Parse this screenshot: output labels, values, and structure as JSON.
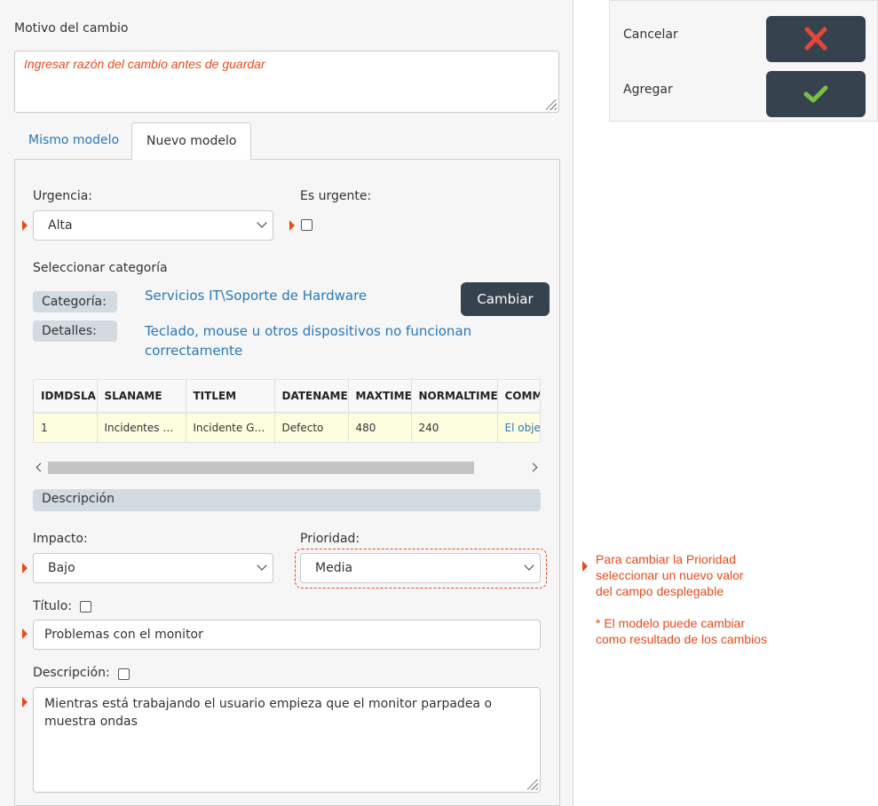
{
  "motivo": {
    "label": "Motivo del cambio",
    "placeholder": "Ingresar razón del cambio antes de guardar"
  },
  "tabs": [
    {
      "label": "Mismo modelo",
      "active": false
    },
    {
      "label": "Nuevo modelo",
      "active": true
    }
  ],
  "urgencia": {
    "label": "Urgencia:",
    "value": "Alta"
  },
  "es_urgente": {
    "label": "Es urgente:",
    "checked": false
  },
  "categoria": {
    "heading": "Seleccionar categoría",
    "categoria_tag": "Categoría:",
    "categoria_value": "Servicios IT\\Soporte de Hardware",
    "detalles_tag": "Detalles:",
    "detalles_value_line1": "Teclado, mouse u otros dispositivos no funcionan",
    "detalles_value_line2": "correctamente",
    "change_button": "Cambiar"
  },
  "table": {
    "headers": [
      "IDMDSLA",
      "SLANAME",
      "TITLEM",
      "DATENAME",
      "MAXTIME",
      "NORMALTIME",
      "COMM"
    ],
    "row": [
      "1",
      "Incidentes g...",
      "Incidente Ge...",
      "Defecto",
      "480",
      "240",
      "El objet"
    ]
  },
  "descripcion_section": "Descripción",
  "impacto": {
    "label": "Impacto:",
    "value": "Bajo"
  },
  "prioridad": {
    "label": "Prioridad:",
    "value": "Media"
  },
  "titulo": {
    "label": "Título:",
    "value": "Problemas con el monitor"
  },
  "descripcion": {
    "label": "Descripción:",
    "value": "Mientras está trabajando el usuario empieza que el monitor parpadea o muestra ondas"
  },
  "actions": {
    "cancel_label": "Cancelar",
    "add_label": "Agregar",
    "cancel_color": "#e8453c",
    "add_color": "#7bc043"
  },
  "note": {
    "line1": "Para cambiar la Prioridad",
    "line2": "seleccionar un nuevo valor",
    "line3": "del campo desplegable",
    "line4": "* El modelo puede cambiar",
    "line5": "como resultado de los cambios"
  },
  "colors": {
    "accent": "#e84a1c",
    "link": "#2a78b8",
    "button_dark": "#36434f",
    "tag_bg": "#d3dbe2"
  }
}
